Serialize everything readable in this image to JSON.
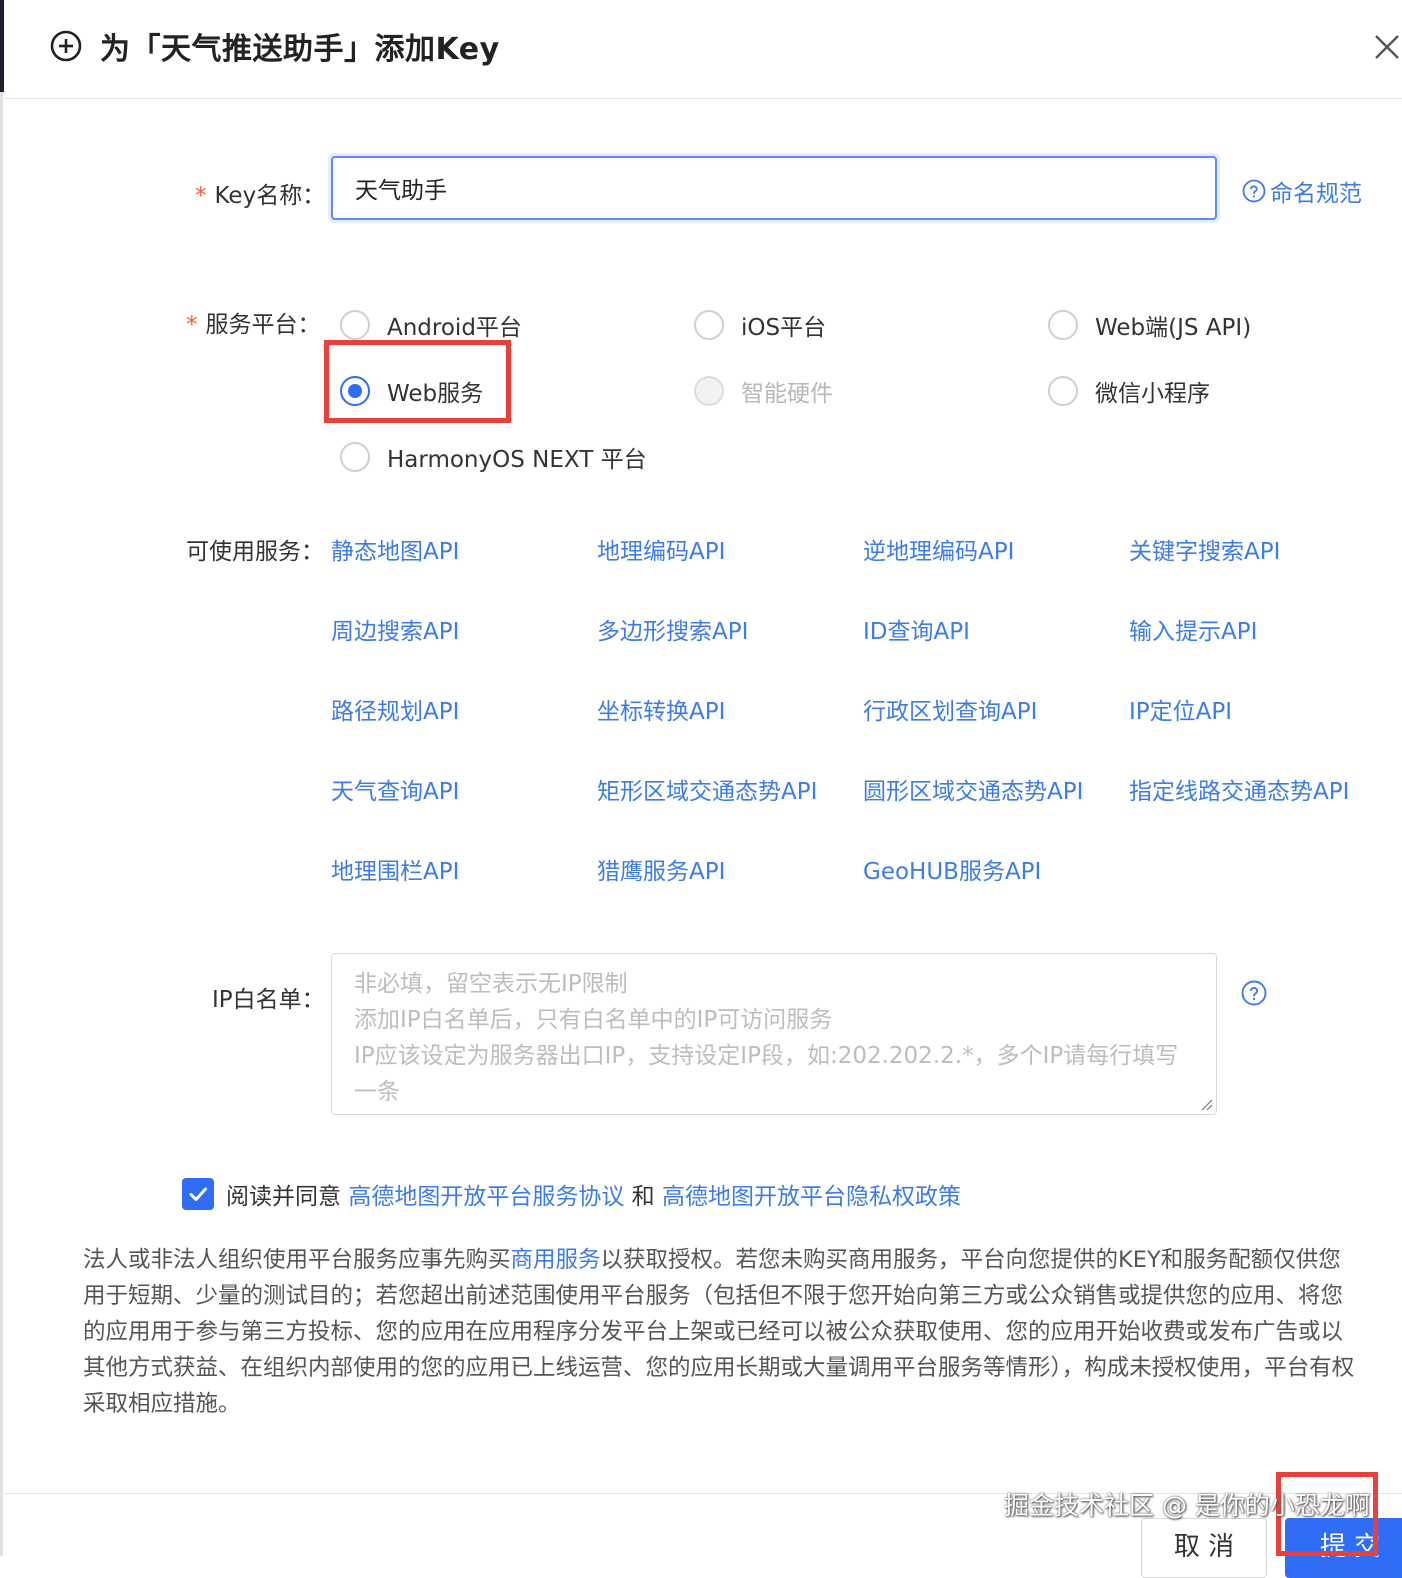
{
  "dialog": {
    "title": "为「天气推送助手」添加Key"
  },
  "form": {
    "key_name": {
      "required_mark": "*",
      "label": "Key名称：",
      "value": "天气助手",
      "naming_link": "命名规范"
    },
    "platform": {
      "required_mark": "*",
      "label": "服务平台：",
      "options": [
        {
          "label": "Android平台",
          "state": "unchecked"
        },
        {
          "label": "iOS平台",
          "state": "unchecked"
        },
        {
          "label": "Web端(JS API)",
          "state": "unchecked"
        },
        {
          "label": "Web服务",
          "state": "checked"
        },
        {
          "label": "智能硬件",
          "state": "disabled"
        },
        {
          "label": "微信小程序",
          "state": "unchecked"
        },
        {
          "label": "HarmonyOS NEXT 平台",
          "state": "unchecked"
        }
      ]
    },
    "services": {
      "label": "可使用服务：",
      "items": [
        "静态地图API",
        "地理编码API",
        "逆地理编码API",
        "关键字搜索API",
        "周边搜索API",
        "多边形搜索API",
        "ID查询API",
        "输入提示API",
        "路径规划API",
        "坐标转换API",
        "行政区划查询API",
        "IP定位API",
        "天气查询API",
        "矩形区域交通态势API",
        "圆形区域交通态势API",
        "指定线路交通态势API",
        "地理围栏API",
        "猎鹰服务API",
        "GeoHUB服务API"
      ]
    },
    "ip_whitelist": {
      "label": "IP白名单：",
      "placeholder_lines": [
        "非必填，留空表示无IP限制",
        "添加IP白名单后，只有白名单中的IP可访问服务",
        "IP应该设定为服务器出口IP，支持设定IP段，如:202.202.2.*，多个IP请每行填写",
        "一条"
      ]
    },
    "agreement": {
      "checked": true,
      "prefix": "阅读并同意",
      "link1": "高德地图开放平台服务协议",
      "and": "和",
      "link2": "高德地图开放平台隐私权政策"
    }
  },
  "notice": {
    "before": "法人或非法人组织使用平台服务应事先购买",
    "link": "商用服务",
    "after": "以获取授权。若您未购买商用服务，平台向您提供的KEY和服务配额仅供您用于短期、少量的测试目的；若您超出前述范围使用平台服务（包括但不限于您开始向第三方或公众销售或提供您的应用、将您的应用用于参与第三方投标、您的应用在应用程序分发平台上架或已经可以被公众获取使用、您的应用开始收费或发布广告或以其他方式获益、在组织内部使用的您的应用已上线运营、您的应用长期或大量调用平台服务等情形），构成未授权使用，平台有权采取相应措施。"
  },
  "footer": {
    "cancel_label": "取 消",
    "submit_label": "提 交"
  },
  "watermark": "掘金技术社区 @ 是你的小恐龙啊",
  "colors": {
    "accent": "#2f6df6",
    "link": "#3d7ce8",
    "highlight": "#e8413b",
    "required": "#f2622d"
  }
}
